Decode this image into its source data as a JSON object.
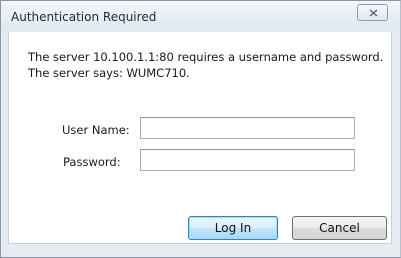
{
  "dialog": {
    "title": "Authentication Required",
    "message_line1": "The server 10.100.1.1:80 requires a username and password.",
    "message_line2": "The server says: WUMC710.",
    "username_label": "User Name:",
    "username_value": "",
    "password_label": "Password:",
    "password_value": "",
    "login_label": "Log In",
    "cancel_label": "Cancel",
    "close_icon": "close-icon"
  }
}
